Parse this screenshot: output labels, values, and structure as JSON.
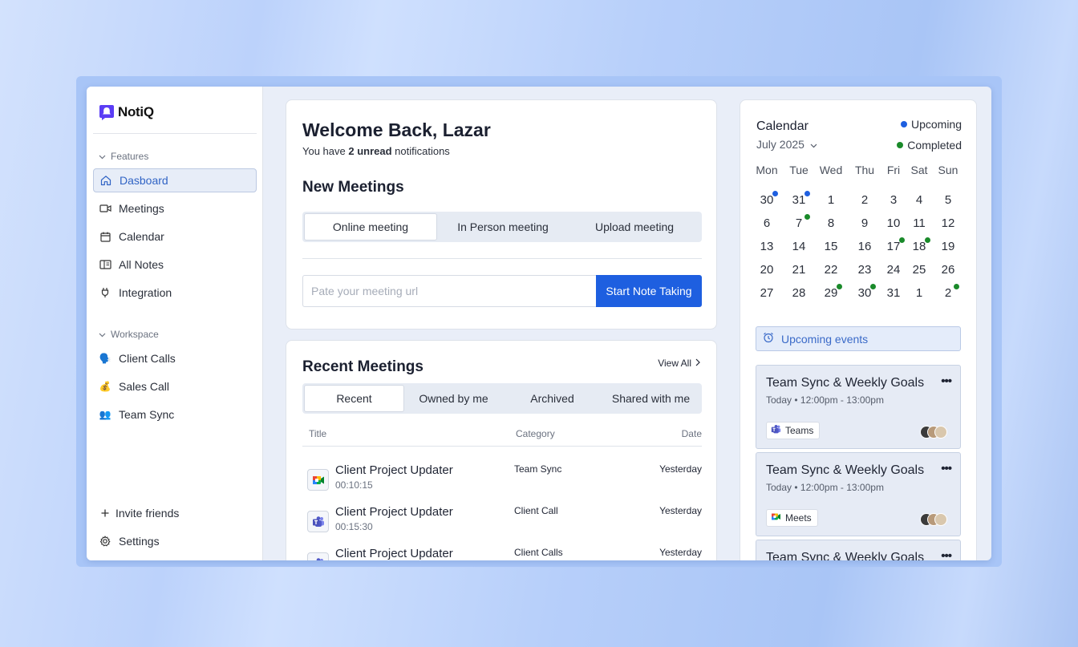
{
  "brand": {
    "name": "NotiQ",
    "color": "#5b3df5"
  },
  "sidebar": {
    "features_label": "Features",
    "items": [
      {
        "label": "Dasboard",
        "icon": "home-icon",
        "active": true
      },
      {
        "label": "Meetings",
        "icon": "video-icon"
      },
      {
        "label": "Calendar",
        "icon": "calendar-icon"
      },
      {
        "label": "All Notes",
        "icon": "notebook-icon"
      },
      {
        "label": "Integration",
        "icon": "plug-icon"
      }
    ],
    "workspace_label": "Workspace",
    "workspace": [
      {
        "label": "Client Calls",
        "icon": "🗣️"
      },
      {
        "label": "Sales Call",
        "icon": "💰"
      },
      {
        "label": "Team Sync",
        "icon": "👥"
      }
    ],
    "invite_label": "Invite friends",
    "settings_label": "Settings"
  },
  "welcome": {
    "title": "Welcome Back, Lazar",
    "sub_prefix": "You have ",
    "sub_bold": "2 unread",
    "sub_suffix": " notifications"
  },
  "new_meetings": {
    "title": "New Meetings",
    "tabs": [
      "Online meeting",
      "In Person meeting",
      "Upload meeting"
    ],
    "active_tab": 0,
    "url_placeholder": "Pate your meeting url",
    "start_label": "Start Note Taking"
  },
  "recent": {
    "title": "Recent Meetings",
    "view_all": "View All",
    "tabs": [
      "Recent",
      "Owned by me",
      "Archived",
      "Shared with me"
    ],
    "active_tab": 0,
    "columns": {
      "title": "Title",
      "category": "Category",
      "date": "Date"
    },
    "rows": [
      {
        "title": "Client Project Updater",
        "duration": "00:10:15",
        "category": "Team Sync",
        "date": "Yesterday",
        "app": "google-meet-icon"
      },
      {
        "title": "Client Project Updater",
        "duration": "00:15:30",
        "category": "Client Call",
        "date": "Yesterday",
        "app": "teams-icon"
      },
      {
        "title": "Client Project Updater",
        "duration": "",
        "category": "Client Calls",
        "date": "Yesterday",
        "app": "teams-icon"
      }
    ]
  },
  "calendar": {
    "title": "Calendar",
    "month": "July 2025",
    "legend": {
      "upcoming": "Upcoming",
      "completed": "Completed",
      "upcoming_color": "#1e5fe0",
      "completed_color": "#1a8a2a"
    },
    "weekdays": [
      "Mon",
      "Tue",
      "Wed",
      "Thu",
      "Fri",
      "Sat",
      "Sun"
    ],
    "weeks": [
      [
        "30",
        "31",
        "1",
        "2",
        "3",
        "4",
        "5"
      ],
      [
        "6",
        "7",
        "8",
        "9",
        "10",
        "11",
        "12"
      ],
      [
        "13",
        "14",
        "15",
        "16",
        "17",
        "18",
        "19"
      ],
      [
        "20",
        "21",
        "22",
        "23",
        "24",
        "25",
        "26"
      ],
      [
        "27",
        "28",
        "29",
        "30",
        "31",
        "1",
        "2"
      ]
    ],
    "markers": [
      {
        "week": 0,
        "day": 0,
        "type": "upcoming"
      },
      {
        "week": 0,
        "day": 1,
        "type": "upcoming"
      },
      {
        "week": 1,
        "day": 1,
        "type": "completed"
      },
      {
        "week": 2,
        "day": 4,
        "type": "completed"
      },
      {
        "week": 2,
        "day": 5,
        "type": "completed"
      },
      {
        "week": 4,
        "day": 2,
        "type": "completed"
      },
      {
        "week": 4,
        "day": 3,
        "type": "completed"
      },
      {
        "week": 4,
        "day": 6,
        "type": "completed"
      }
    ],
    "upcoming_events_label": "Upcoming events",
    "events": [
      {
        "title": "Team Sync & Weekly Goals",
        "time": "Today • 12:00pm - 13:00pm",
        "app": "Teams",
        "app_icon": "teams-icon",
        "more": "•••"
      },
      {
        "title": "Team Sync & Weekly Goals",
        "time": "Today • 12:00pm - 13:00pm",
        "app": "Meets",
        "app_icon": "google-meet-icon",
        "more": "•••"
      },
      {
        "title": "Team Sync & Weekly Goals",
        "time": "",
        "app": "",
        "app_icon": "",
        "more": "•••"
      }
    ]
  }
}
